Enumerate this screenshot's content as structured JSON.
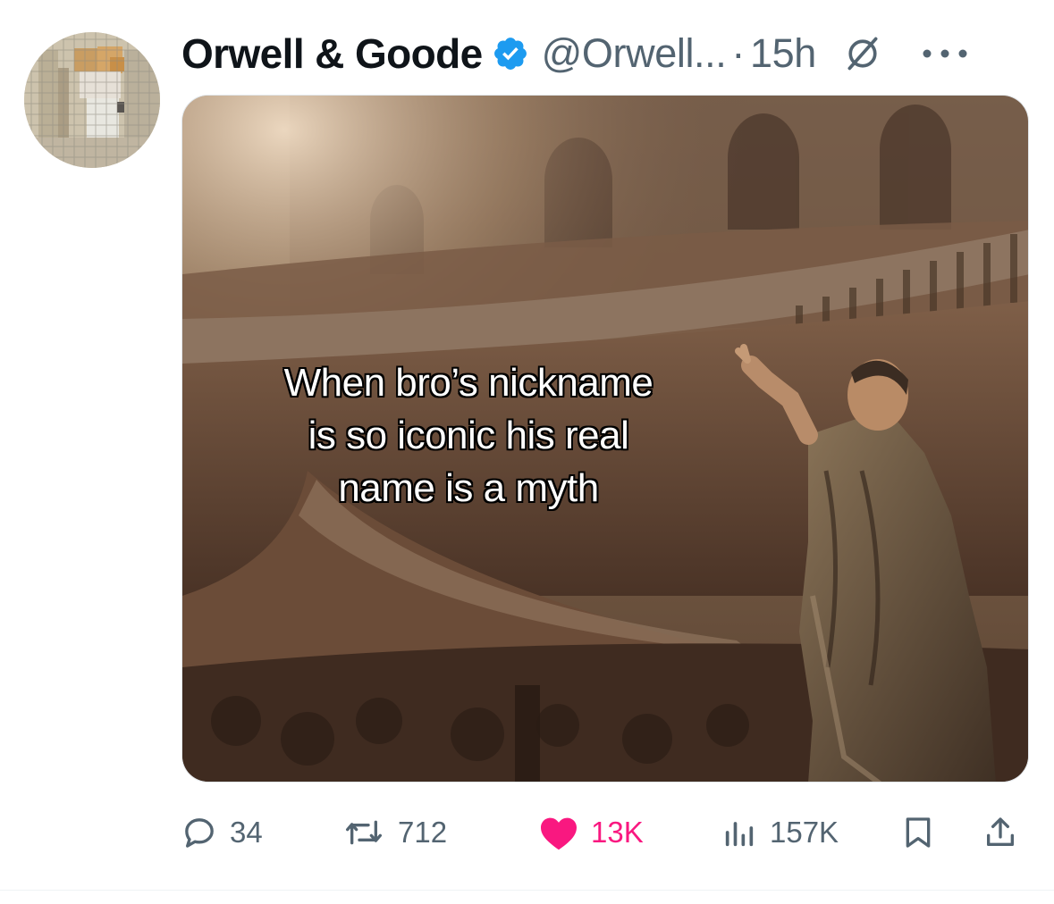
{
  "post": {
    "author": {
      "display_name": "Orwell & Goode",
      "handle": "@Orwell...",
      "verified": true,
      "avatar_icon": "pixelated-avatar"
    },
    "separator": "·",
    "timestamp": "15h",
    "media": {
      "caption_lines": [
        "When bro’s nickname",
        "is so iconic his real",
        "name is a myth"
      ]
    },
    "actions": {
      "replies": "34",
      "reposts": "712",
      "likes": "13K",
      "views": "157K"
    },
    "icons": {
      "verified": "verified-badge-icon",
      "grok": "grok-icon",
      "more": "more-icon",
      "reply": "reply-icon",
      "repost": "repost-icon",
      "like": "heart-icon",
      "views": "views-icon",
      "bookmark": "bookmark-icon",
      "share": "share-icon"
    },
    "colors": {
      "verified": "#1d9bf0",
      "like": "#f91880",
      "muted": "#536471"
    }
  }
}
